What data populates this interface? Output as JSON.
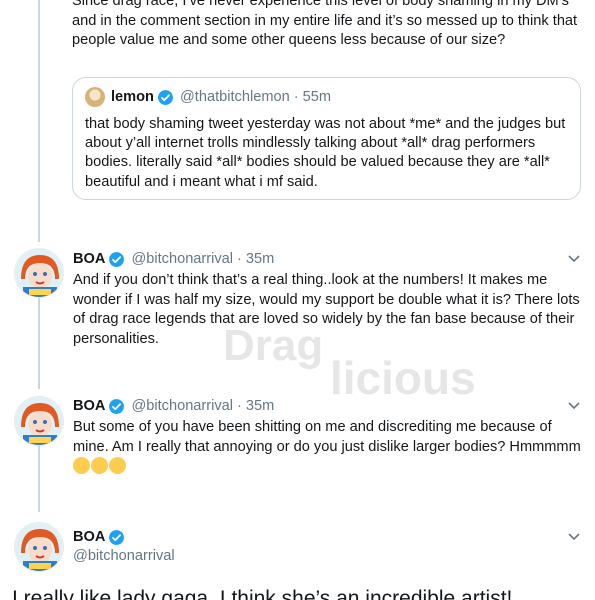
{
  "top_tweet": {
    "text": "Since drag race, I’ve never experience this level of body shaming in my DM’s and in the comment section in my entire life and it’s so messed up to think that people value me and some other queens less because of our size?"
  },
  "quoted_tweet": {
    "name": "lemon",
    "handle": "@thatbitchlemon",
    "separator": "·",
    "time": "55m",
    "text": "that body shaming tweet yesterday was not about *me* and the judges but about y’all internet trolls mindlessly talking about *all* drag performers bodies. literally said *all* bodies should be valued because they are *all* beautiful and i meant what i mf said."
  },
  "tweets": [
    {
      "name": "BOA",
      "handle": "@bitchonarrival",
      "separator": "·",
      "time": "35m",
      "text": "And if you don’t think that’s a real thing..look at the numbers! It makes me wonder if I was half my size, would my support be double  what it is? There lots of drag race legends that are loved so widely by the fan base because of their personalities."
    },
    {
      "name": "BOA",
      "handle": "@bitchonarrival",
      "separator": "·",
      "time": "35m",
      "text": "But some of you have been shitting on me and discrediting me because of mine. Am I really that annoying or do you just dislike larger bodies? Hmmmmm"
    },
    {
      "name": "BOA",
      "handle": "@bitchonarrival"
    }
  ],
  "bottom_text": "I really like lady gaga. I think she’s an incredible artist!",
  "watermark": {
    "text_top": "Drag",
    "text_bottom": "licious"
  },
  "icons": {
    "verified": "verified-badge-icon",
    "chevron": "chevron-down-icon",
    "emoji": [
      "woozy-face-emoji-icon",
      "hugging-face-emoji-icon",
      "thinking-face-emoji-icon"
    ]
  },
  "colors": {
    "verified_blue": "#1da1f2",
    "muted_text": "#657786",
    "border": "#ccd6dd"
  }
}
